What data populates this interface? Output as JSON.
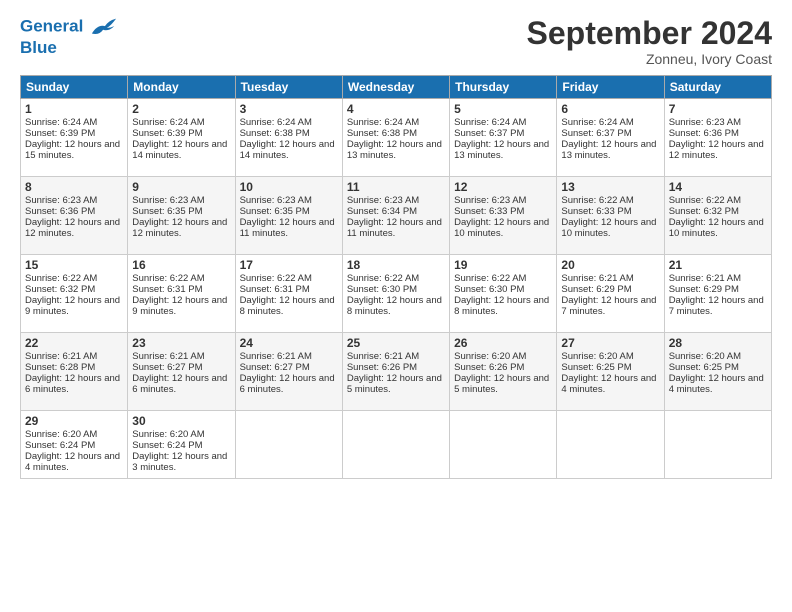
{
  "header": {
    "logo_line1": "General",
    "logo_line2": "Blue",
    "month_title": "September 2024",
    "location": "Zonneu, Ivory Coast"
  },
  "days_of_week": [
    "Sunday",
    "Monday",
    "Tuesday",
    "Wednesday",
    "Thursday",
    "Friday",
    "Saturday"
  ],
  "weeks": [
    [
      {
        "day": "1",
        "sunrise": "Sunrise: 6:24 AM",
        "sunset": "Sunset: 6:39 PM",
        "daylight": "Daylight: 12 hours and 15 minutes."
      },
      {
        "day": "2",
        "sunrise": "Sunrise: 6:24 AM",
        "sunset": "Sunset: 6:39 PM",
        "daylight": "Daylight: 12 hours and 14 minutes."
      },
      {
        "day": "3",
        "sunrise": "Sunrise: 6:24 AM",
        "sunset": "Sunset: 6:38 PM",
        "daylight": "Daylight: 12 hours and 14 minutes."
      },
      {
        "day": "4",
        "sunrise": "Sunrise: 6:24 AM",
        "sunset": "Sunset: 6:38 PM",
        "daylight": "Daylight: 12 hours and 13 minutes."
      },
      {
        "day": "5",
        "sunrise": "Sunrise: 6:24 AM",
        "sunset": "Sunset: 6:37 PM",
        "daylight": "Daylight: 12 hours and 13 minutes."
      },
      {
        "day": "6",
        "sunrise": "Sunrise: 6:24 AM",
        "sunset": "Sunset: 6:37 PM",
        "daylight": "Daylight: 12 hours and 13 minutes."
      },
      {
        "day": "7",
        "sunrise": "Sunrise: 6:23 AM",
        "sunset": "Sunset: 6:36 PM",
        "daylight": "Daylight: 12 hours and 12 minutes."
      }
    ],
    [
      {
        "day": "8",
        "sunrise": "Sunrise: 6:23 AM",
        "sunset": "Sunset: 6:36 PM",
        "daylight": "Daylight: 12 hours and 12 minutes."
      },
      {
        "day": "9",
        "sunrise": "Sunrise: 6:23 AM",
        "sunset": "Sunset: 6:35 PM",
        "daylight": "Daylight: 12 hours and 12 minutes."
      },
      {
        "day": "10",
        "sunrise": "Sunrise: 6:23 AM",
        "sunset": "Sunset: 6:35 PM",
        "daylight": "Daylight: 12 hours and 11 minutes."
      },
      {
        "day": "11",
        "sunrise": "Sunrise: 6:23 AM",
        "sunset": "Sunset: 6:34 PM",
        "daylight": "Daylight: 12 hours and 11 minutes."
      },
      {
        "day": "12",
        "sunrise": "Sunrise: 6:23 AM",
        "sunset": "Sunset: 6:33 PM",
        "daylight": "Daylight: 12 hours and 10 minutes."
      },
      {
        "day": "13",
        "sunrise": "Sunrise: 6:22 AM",
        "sunset": "Sunset: 6:33 PM",
        "daylight": "Daylight: 12 hours and 10 minutes."
      },
      {
        "day": "14",
        "sunrise": "Sunrise: 6:22 AM",
        "sunset": "Sunset: 6:32 PM",
        "daylight": "Daylight: 12 hours and 10 minutes."
      }
    ],
    [
      {
        "day": "15",
        "sunrise": "Sunrise: 6:22 AM",
        "sunset": "Sunset: 6:32 PM",
        "daylight": "Daylight: 12 hours and 9 minutes."
      },
      {
        "day": "16",
        "sunrise": "Sunrise: 6:22 AM",
        "sunset": "Sunset: 6:31 PM",
        "daylight": "Daylight: 12 hours and 9 minutes."
      },
      {
        "day": "17",
        "sunrise": "Sunrise: 6:22 AM",
        "sunset": "Sunset: 6:31 PM",
        "daylight": "Daylight: 12 hours and 8 minutes."
      },
      {
        "day": "18",
        "sunrise": "Sunrise: 6:22 AM",
        "sunset": "Sunset: 6:30 PM",
        "daylight": "Daylight: 12 hours and 8 minutes."
      },
      {
        "day": "19",
        "sunrise": "Sunrise: 6:22 AM",
        "sunset": "Sunset: 6:30 PM",
        "daylight": "Daylight: 12 hours and 8 minutes."
      },
      {
        "day": "20",
        "sunrise": "Sunrise: 6:21 AM",
        "sunset": "Sunset: 6:29 PM",
        "daylight": "Daylight: 12 hours and 7 minutes."
      },
      {
        "day": "21",
        "sunrise": "Sunrise: 6:21 AM",
        "sunset": "Sunset: 6:29 PM",
        "daylight": "Daylight: 12 hours and 7 minutes."
      }
    ],
    [
      {
        "day": "22",
        "sunrise": "Sunrise: 6:21 AM",
        "sunset": "Sunset: 6:28 PM",
        "daylight": "Daylight: 12 hours and 6 minutes."
      },
      {
        "day": "23",
        "sunrise": "Sunrise: 6:21 AM",
        "sunset": "Sunset: 6:27 PM",
        "daylight": "Daylight: 12 hours and 6 minutes."
      },
      {
        "day": "24",
        "sunrise": "Sunrise: 6:21 AM",
        "sunset": "Sunset: 6:27 PM",
        "daylight": "Daylight: 12 hours and 6 minutes."
      },
      {
        "day": "25",
        "sunrise": "Sunrise: 6:21 AM",
        "sunset": "Sunset: 6:26 PM",
        "daylight": "Daylight: 12 hours and 5 minutes."
      },
      {
        "day": "26",
        "sunrise": "Sunrise: 6:20 AM",
        "sunset": "Sunset: 6:26 PM",
        "daylight": "Daylight: 12 hours and 5 minutes."
      },
      {
        "day": "27",
        "sunrise": "Sunrise: 6:20 AM",
        "sunset": "Sunset: 6:25 PM",
        "daylight": "Daylight: 12 hours and 4 minutes."
      },
      {
        "day": "28",
        "sunrise": "Sunrise: 6:20 AM",
        "sunset": "Sunset: 6:25 PM",
        "daylight": "Daylight: 12 hours and 4 minutes."
      }
    ],
    [
      {
        "day": "29",
        "sunrise": "Sunrise: 6:20 AM",
        "sunset": "Sunset: 6:24 PM",
        "daylight": "Daylight: 12 hours and 4 minutes."
      },
      {
        "day": "30",
        "sunrise": "Sunrise: 6:20 AM",
        "sunset": "Sunset: 6:24 PM",
        "daylight": "Daylight: 12 hours and 3 minutes."
      },
      null,
      null,
      null,
      null,
      null
    ]
  ]
}
